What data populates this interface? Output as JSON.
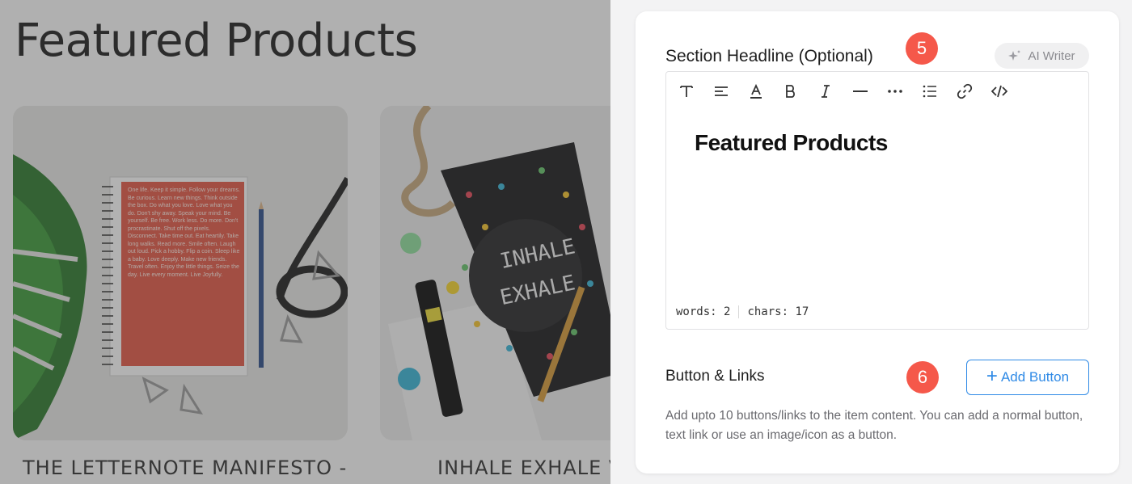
{
  "preview": {
    "title": "Featured Products",
    "products": [
      {
        "name": "THE LETTERNOTE MANIFESTO -"
      },
      {
        "name": "INHALE EXHALE V"
      }
    ],
    "notebook_text": "One life. Keep it simple. Follow your dreams. Be curious. Learn new things. Think outside the box. Do what you love. Love what you do. Don't shy away. Speak your mind. Be yourself. Be free. Work less. Do more. Don't procrastinate. Shut off the pixels. Disconnect. Take time out. Eat heartily. Take long walks. Read more. Smile often. Laugh out loud. Pick a hobby. Flip a coin. Sleep like a baby. Love deeply. Make new friends. Travel often. Enjoy the little things. Seize the day. Live every moment. Live Joyfully.",
    "cover_text_1": "INHALE",
    "cover_text_2": "EXHALE"
  },
  "panel": {
    "headline_label": "Section Headline (Optional)",
    "badge_5": "5",
    "ai_writer": "AI Writer",
    "toolbar": [
      {
        "name": "text-format-icon"
      },
      {
        "name": "align-icon"
      },
      {
        "name": "text-color-icon"
      },
      {
        "name": "bold-icon"
      },
      {
        "name": "italic-icon"
      },
      {
        "name": "horizontal-rule-icon"
      },
      {
        "name": "more-icon"
      },
      {
        "name": "list-icon"
      },
      {
        "name": "link-icon"
      },
      {
        "name": "code-icon"
      }
    ],
    "editor_content": "Featured Products",
    "words_label": "words: 2",
    "chars_label": "chars: 17",
    "links_label": "Button & Links",
    "badge_6": "6",
    "add_button": "Add Button",
    "help_text": "Add upto 10 buttons/links to the item content. You can add a normal button, text link or use an image/icon as a button.",
    "accent_color": "#2f8ae6",
    "badge_color": "#f5584a"
  }
}
